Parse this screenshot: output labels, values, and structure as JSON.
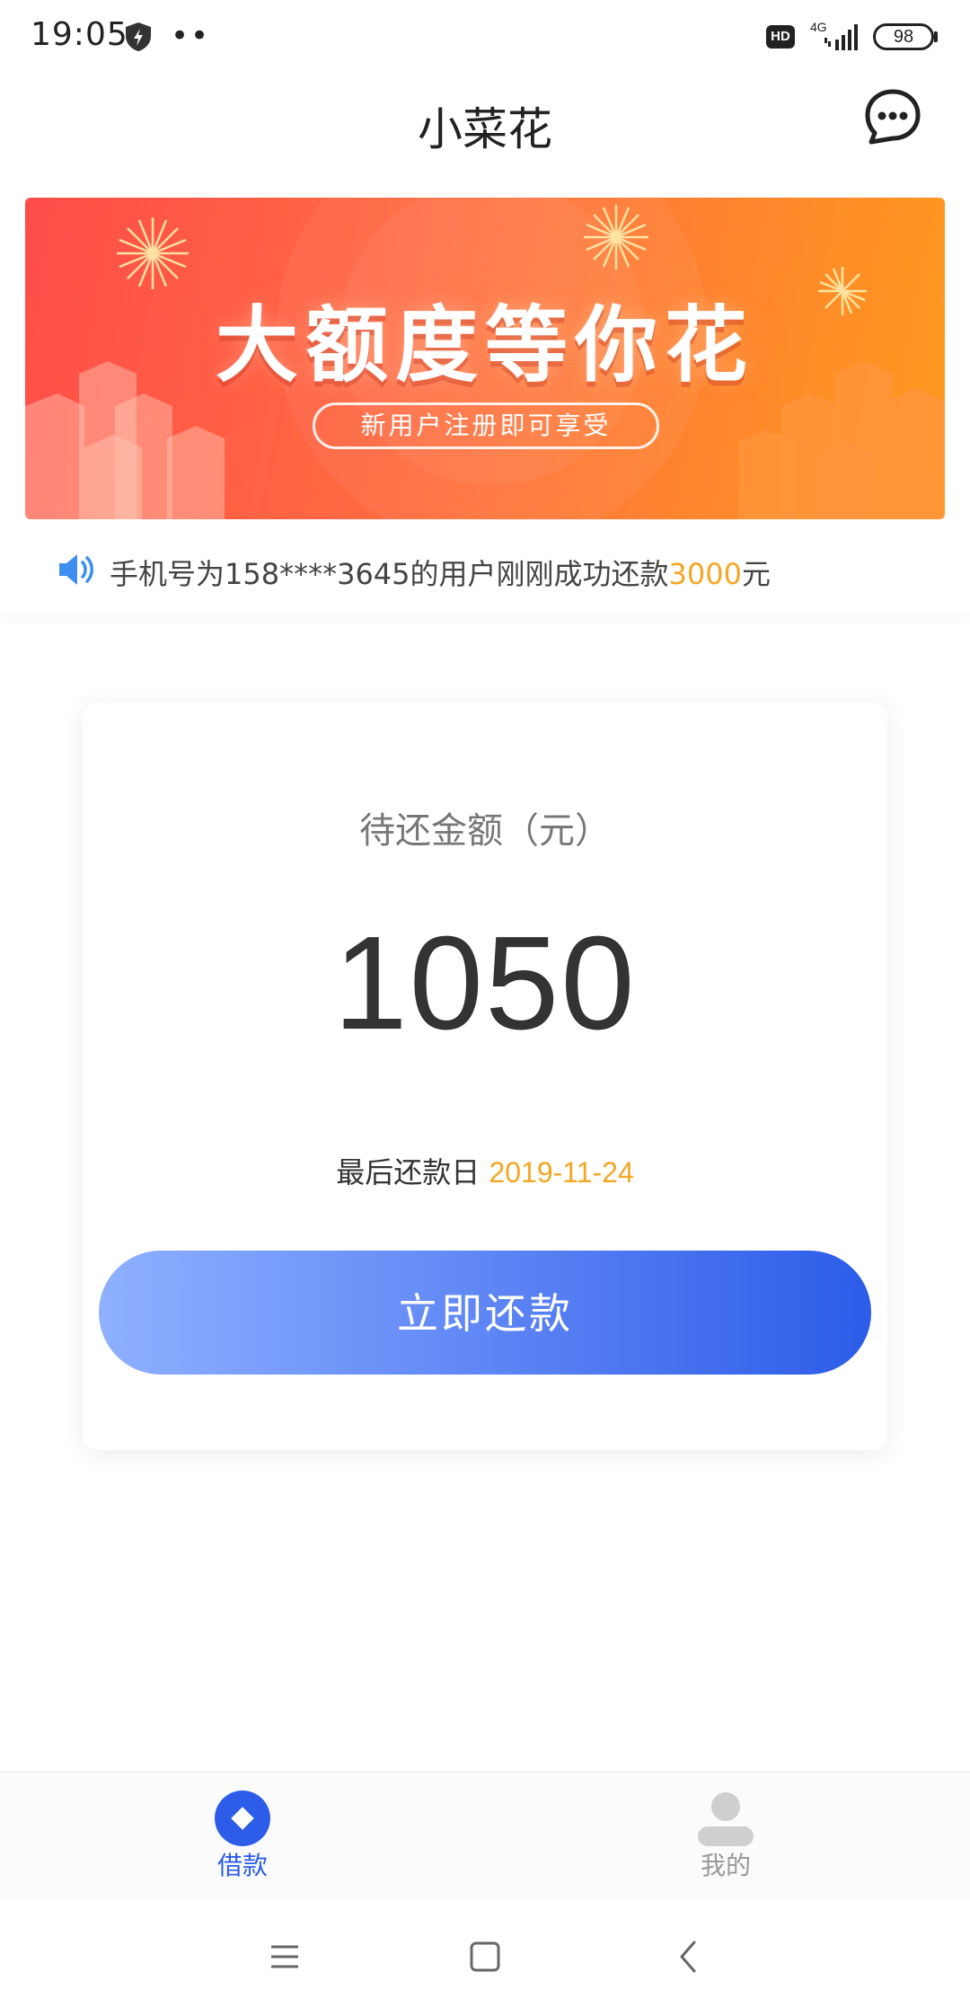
{
  "status_bar": {
    "time": "19:05",
    "more_indicator": "••",
    "hd_label": "HD",
    "network_label": "4G",
    "battery_level": "98"
  },
  "header": {
    "title": "小菜花",
    "menu_icon": "chat-bubble-dots-icon"
  },
  "banner": {
    "headline": "大额度等你花",
    "subline": "新用户注册即可享受",
    "colors": {
      "start": "#ff4d4a",
      "end": "#ff9a1f"
    }
  },
  "notice": {
    "icon": "speaker-icon",
    "prefix": "手机号为158****3645的用户刚刚成功还款",
    "amount": "3000",
    "suffix": "元"
  },
  "repay_card": {
    "label": "待还金额（元）",
    "amount": "1050",
    "due_label": "最后还款日",
    "due_date": "2019-11-24",
    "button_label": "立即还款"
  },
  "tab_bar": {
    "tabs": [
      {
        "label": "借款",
        "icon": "diamond-icon",
        "active": true
      },
      {
        "label": "我的",
        "icon": "person-icon",
        "active": false
      }
    ]
  },
  "nav_bar": {
    "buttons": [
      "menu-icon",
      "home-icon",
      "back-icon"
    ]
  },
  "colors": {
    "accent_blue": "#2c5ce8",
    "highlight_orange": "#f5a623"
  }
}
